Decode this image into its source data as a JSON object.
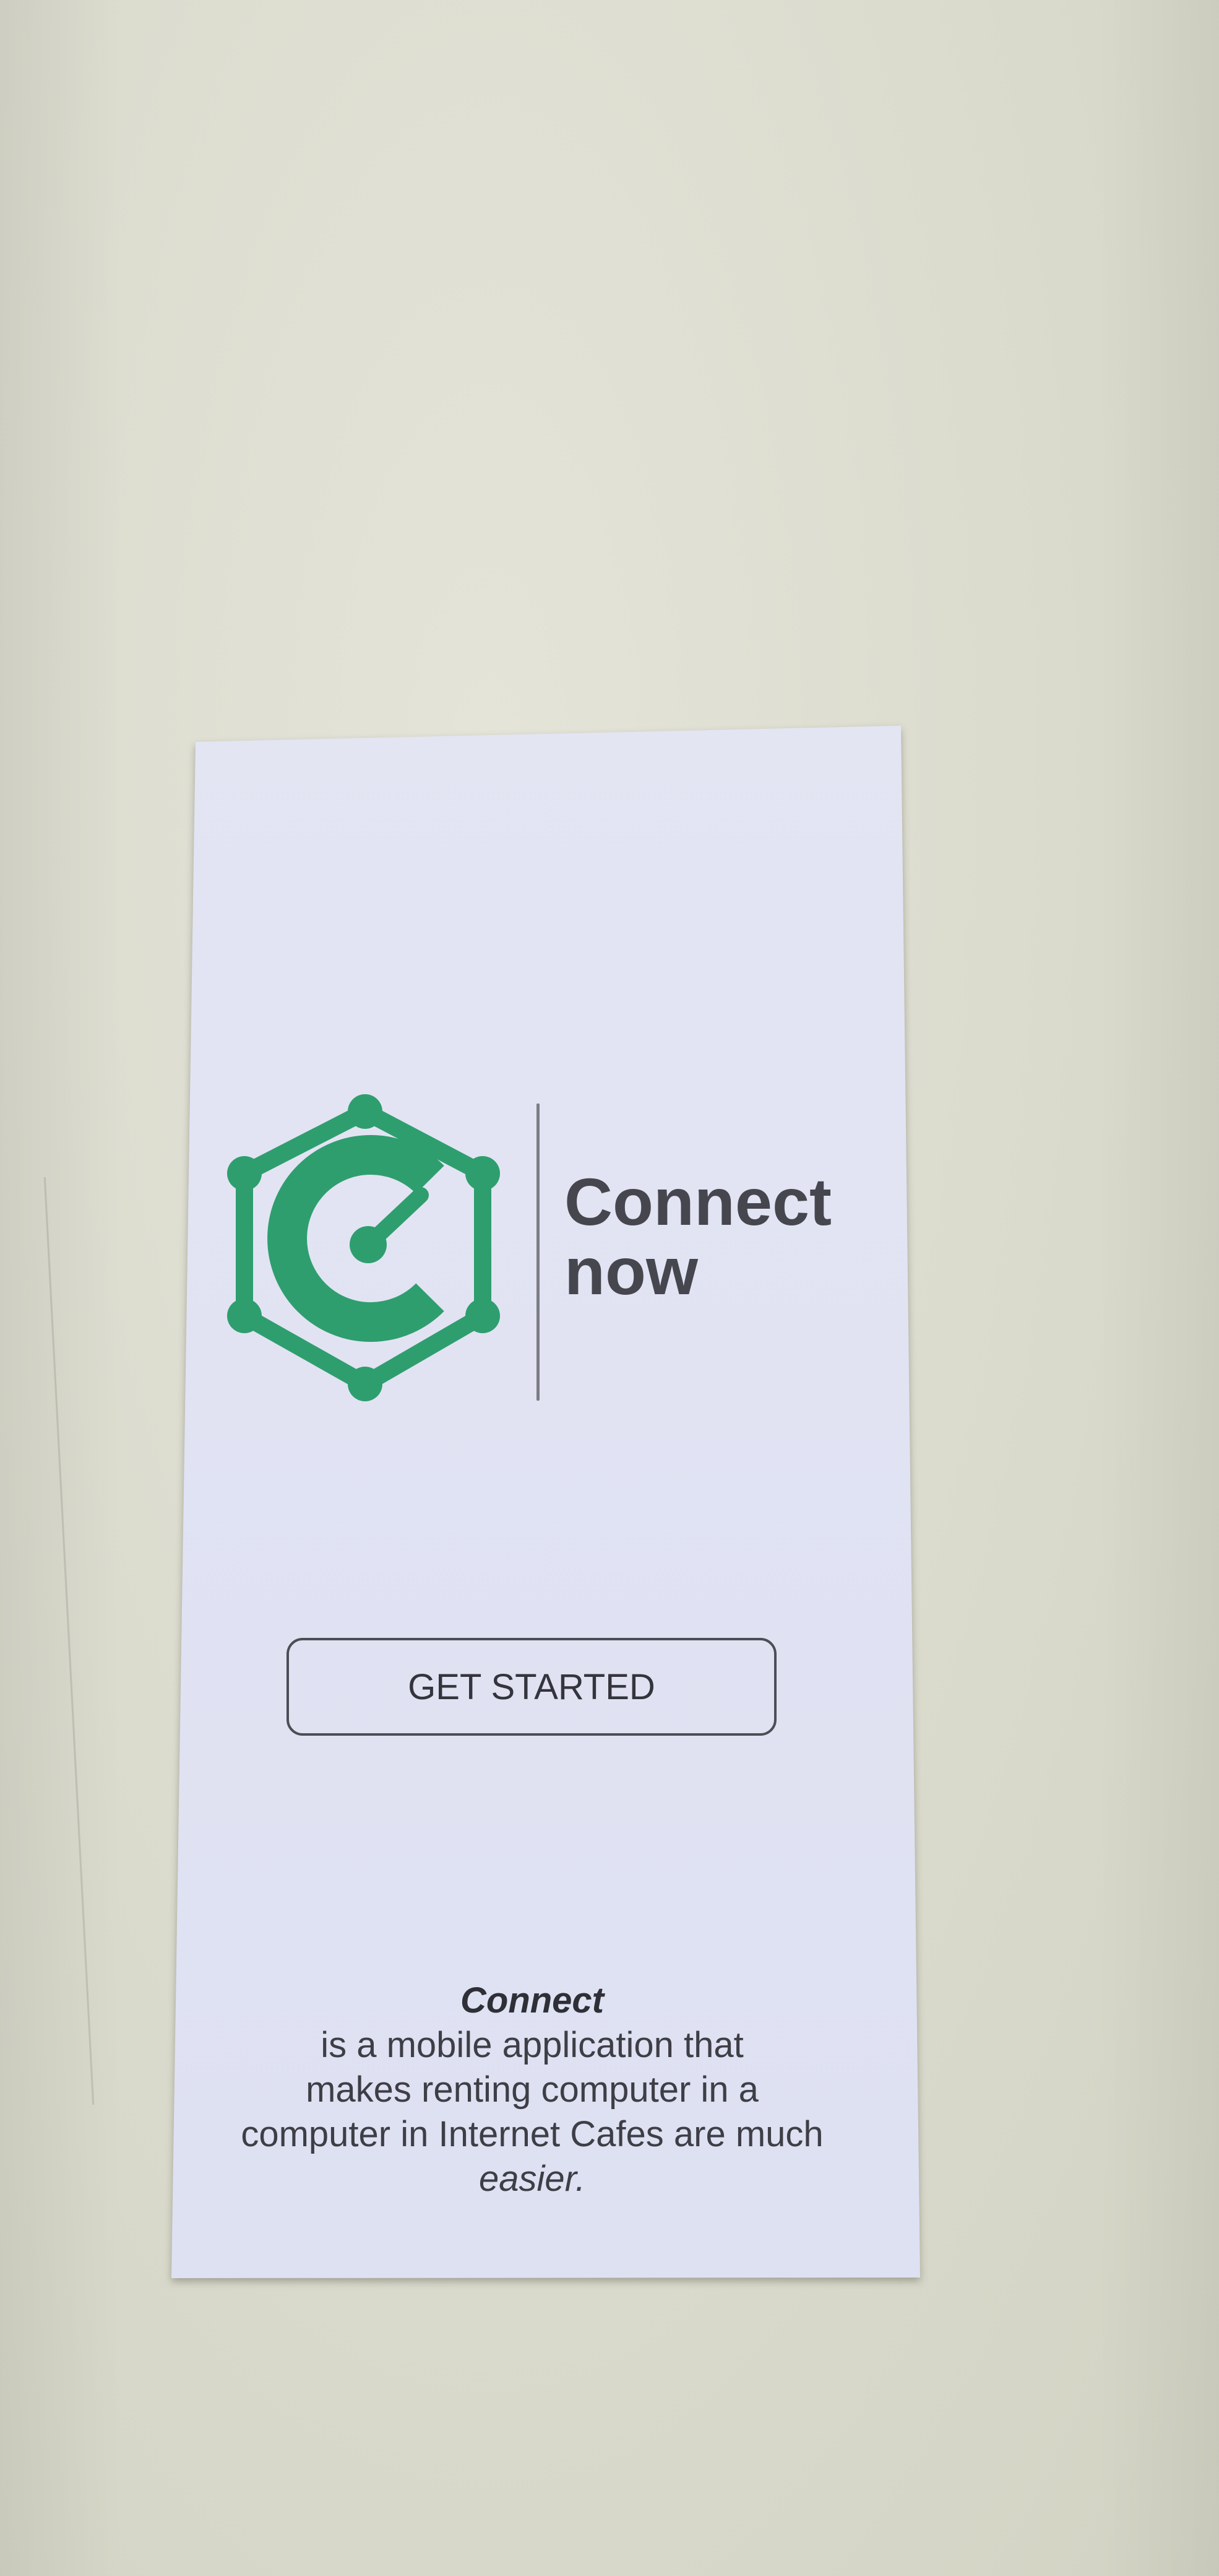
{
  "brand": {
    "line1": "Connect",
    "line2": "now",
    "logo_icon": "connect-hexagon-c-logo",
    "accent_color": "#2e9e6e"
  },
  "cta": {
    "label": "GET STARTED"
  },
  "description": {
    "name": "Connect",
    "line1": "is a mobile application that",
    "line2": "makes renting computer in a",
    "line3": "computer in Internet Cafes are much",
    "line4": "easier."
  }
}
